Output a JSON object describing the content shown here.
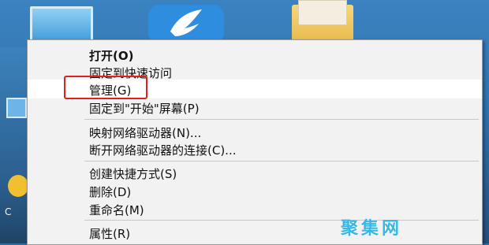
{
  "desktop": {
    "icons": [
      "this-pc-icon",
      "feather-app-icon",
      "folder-icon"
    ],
    "partial_label": "C"
  },
  "context_menu": {
    "items": [
      {
        "label": "打开(O)",
        "bold": true
      },
      {
        "label": "固定到快速访问"
      },
      {
        "label": "管理(G)",
        "highlighted": true
      },
      {
        "label": "固定到\"开始\"屏幕(P)"
      },
      {
        "label": "映射网络驱动器(N)..."
      },
      {
        "label": "断开网络驱动器的连接(C)..."
      },
      {
        "label": "创建快捷方式(S)"
      },
      {
        "label": "删除(D)"
      },
      {
        "label": "重命名(M)"
      },
      {
        "label": "属性(R)"
      }
    ]
  },
  "watermark": "聚集网",
  "colors": {
    "menu_bg": "#f2f2f2",
    "highlight_border": "#e02020",
    "watermark": "#38b7e6"
  }
}
